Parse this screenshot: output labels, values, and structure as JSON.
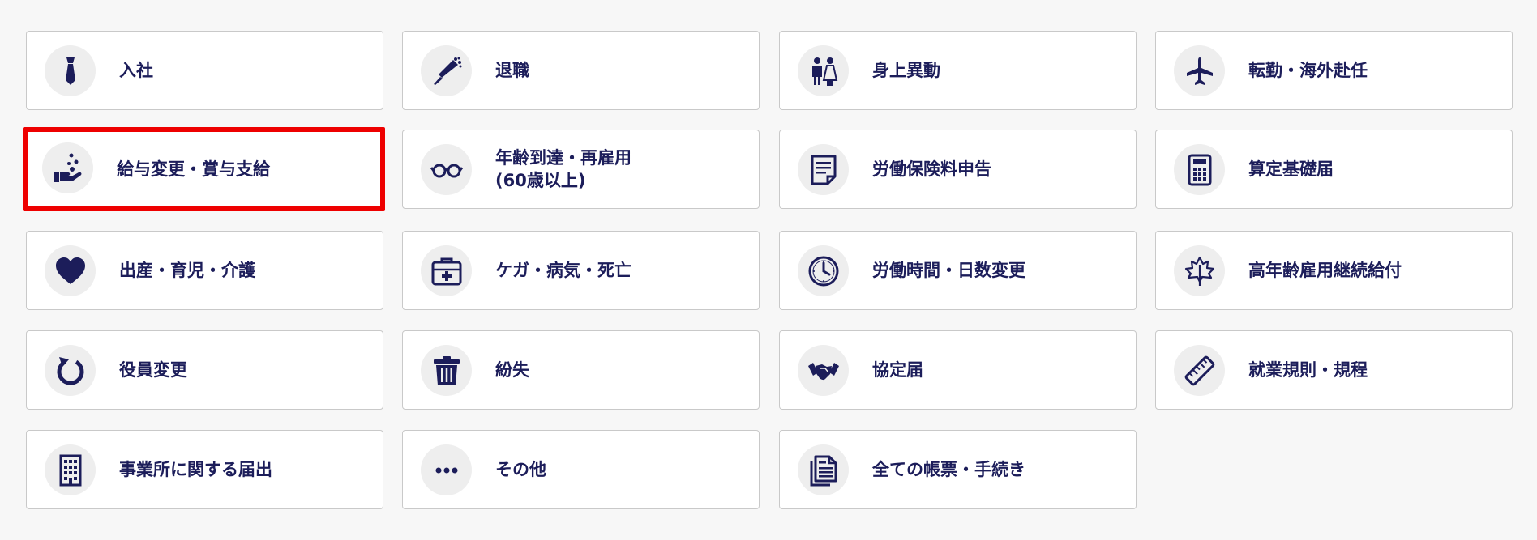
{
  "accent_color": "#1c1d5a",
  "selected_border_color": "#ee0000",
  "procedures": [
    {
      "label": "入社",
      "icon": "necktie-icon"
    },
    {
      "label": "退職",
      "icon": "bouquet-icon"
    },
    {
      "label": "身上異動",
      "icon": "wedding-couple-icon"
    },
    {
      "label": "転勤・海外赴任",
      "icon": "airplane-icon"
    },
    {
      "label": "給与変更・賞与支給",
      "icon": "hand-coins-icon",
      "selected": true
    },
    {
      "label": "年齢到達・再雇用\n(60歳以上)",
      "icon": "glasses-icon"
    },
    {
      "label": "労働保険料申告",
      "icon": "document-icon"
    },
    {
      "label": "算定基礎届",
      "icon": "calculator-icon"
    },
    {
      "label": "出産・育児・介護",
      "icon": "heart-icon"
    },
    {
      "label": "ケガ・病気・死亡",
      "icon": "first-aid-kit-icon"
    },
    {
      "label": "労働時間・日数変更",
      "icon": "clock-icon"
    },
    {
      "label": "高年齢雇用継続給付",
      "icon": "maple-leaf-icon"
    },
    {
      "label": "役員変更",
      "icon": "refresh-icon"
    },
    {
      "label": "紛失",
      "icon": "trash-icon"
    },
    {
      "label": "協定届",
      "icon": "handshake-icon"
    },
    {
      "label": "就業規則・規程",
      "icon": "ruler-icon"
    },
    {
      "label": "事業所に関する届出",
      "icon": "building-icon"
    },
    {
      "label": "その他",
      "icon": "more-dots-icon"
    },
    {
      "label": "全ての帳票・手続き",
      "icon": "documents-icon"
    }
  ]
}
